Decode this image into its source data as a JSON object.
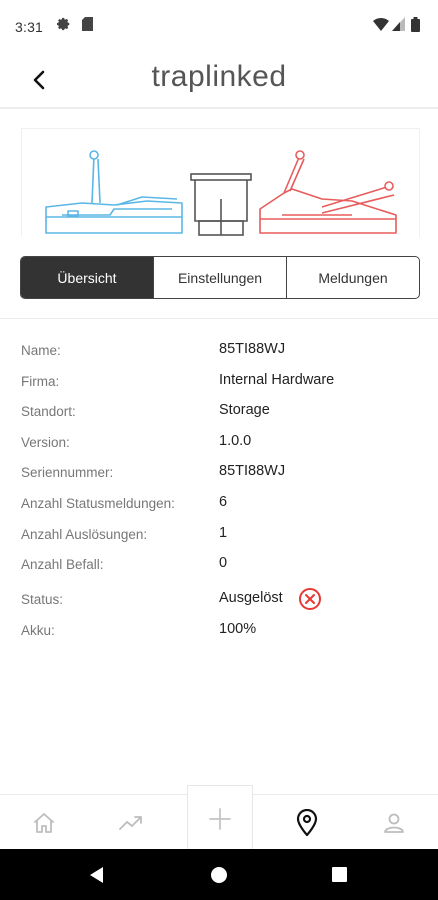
{
  "status_bar": {
    "time": "3:31",
    "icons": [
      "gear-icon",
      "sd-card-icon",
      "wifi-icon",
      "signal-icon",
      "battery-icon"
    ]
  },
  "header": {
    "title": "traplinked",
    "back_icon": "back-arrow-icon"
  },
  "tabs": [
    {
      "label": "Übersicht",
      "active": true
    },
    {
      "label": "Einstellungen",
      "active": false
    },
    {
      "label": "Meldungen",
      "active": false
    }
  ],
  "details": [
    {
      "key": "Name:",
      "value": "85TI88WJ"
    },
    {
      "key": "Firma:",
      "value": "Internal Hardware"
    },
    {
      "key": "Standort:",
      "value": "Storage"
    },
    {
      "key": "Version:",
      "value": "1.0.0"
    },
    {
      "key": "Seriennummer:",
      "value": "85TI88WJ"
    },
    {
      "key": "Anzahl Statusmeldungen:",
      "value": "6"
    },
    {
      "key": "Anzahl Auslösungen:",
      "value": "1"
    },
    {
      "key": "Anzahl Befall:",
      "value": "0"
    },
    {
      "key": "Status:",
      "value": "Ausgelöst",
      "icon": "error-x-icon"
    },
    {
      "key": "Akku:",
      "value": "100%"
    }
  ],
  "bottom_nav": [
    "home-icon",
    "trending-icon",
    "add-icon",
    "location-pin-icon",
    "profile-icon"
  ],
  "colors": {
    "accent_active_tab": "#333333",
    "status_error": "#e53935",
    "trap_open": "#5bb6e6",
    "trap_triggered": "#e85c5c"
  }
}
